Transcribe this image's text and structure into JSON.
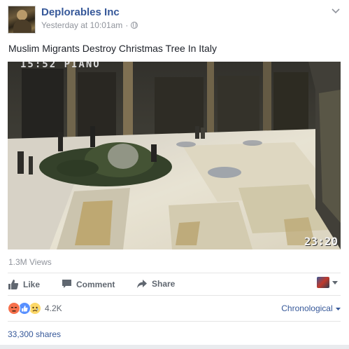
{
  "post": {
    "page_name": "Deplorables Inc",
    "timestamp": "Yesterday at 10:01am",
    "separator": "·",
    "caption": "Muslim Migrants Destroy Christmas Tree In Italy",
    "video": {
      "overlay_text": "15:52  PIANO",
      "timecode": "23:20"
    },
    "views": "1.3M Views",
    "actions": {
      "like": "Like",
      "comment": "Comment",
      "share": "Share"
    },
    "reactions": {
      "icons": [
        "angry-icon",
        "like-reaction-icon",
        "sad-icon"
      ],
      "count": "4.2K"
    },
    "sort_label": "Chronological",
    "shares": "33,300 shares"
  },
  "colors": {
    "link": "#365899",
    "secondary_text": "#90949c",
    "action_text": "#606770",
    "like_blue": "#5890ff",
    "angry_orange": "#f7714c",
    "sad_yellow": "#fcd869"
  }
}
